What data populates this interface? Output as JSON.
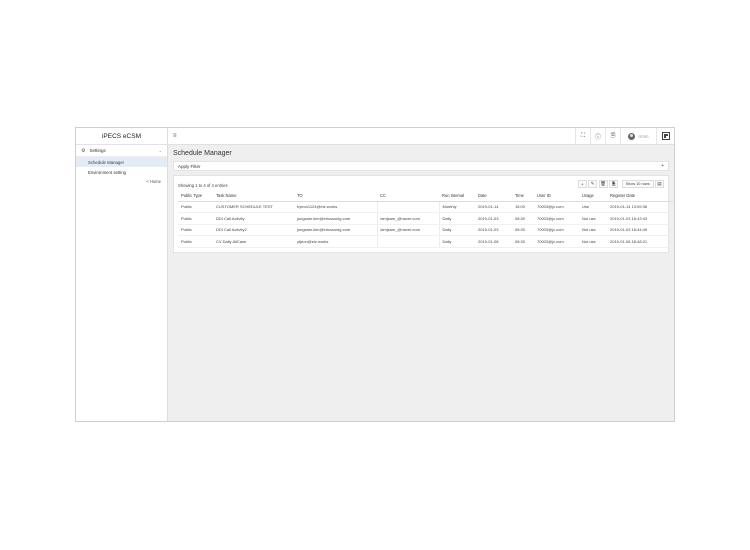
{
  "app": {
    "title": "iPECS eCSM"
  },
  "sidebar": {
    "group_label": "Settings",
    "items": [
      {
        "label": "Schedule Manager",
        "active": true
      },
      {
        "label": "Environment setting",
        "active": false
      }
    ],
    "home_link": "< Home"
  },
  "topbar": {
    "user_name": "rrmm"
  },
  "main": {
    "page_title": "Schedule Manager",
    "filter_label": "Apply Filter",
    "showing_text": "Showing 1 to 4 of 4 entries",
    "rows_button": "Show 10 rows",
    "table": {
      "columns": [
        "Public Type",
        "Task Name",
        "TO",
        "CC",
        "Run Interval",
        "Date",
        "Time",
        "User ID",
        "Usage",
        "Register Date"
      ],
      "rows": [
        [
          "Public",
          "CUSTOMER SCHEDULE TEST",
          "hyeon1124@elz.works",
          "",
          "Monthly",
          "2019-01-14",
          "16:00",
          "70003@jc.com",
          "Use",
          "2019-01-14 13:59:36"
        ],
        [
          "Public",
          "DDI Call Activity",
          "jongsam.kim@ericssonlg.com",
          "kimjsam_@naver.com",
          "Daily",
          "2019-01-03",
          "08:30",
          "70003@jc.com",
          "Not use",
          "2019-01-03 16:43:43"
        ],
        [
          "Public",
          "DDI Call Activity2",
          "jongsam.kim@ericssonlg.com",
          "kimjsam_@naver.com",
          "Daily",
          "2019-01-03",
          "08:30",
          "70003@jc.com",
          "Not use",
          "2019-01-03 16:44:49"
        ],
        [
          "Public",
          "CV Daily AllCase",
          "ytjeon@elz.works",
          "",
          "Daily",
          "2019-01-08",
          "08:30",
          "70003@jc.com",
          "Not use",
          "2019-01-08 18:48:21"
        ]
      ]
    }
  }
}
